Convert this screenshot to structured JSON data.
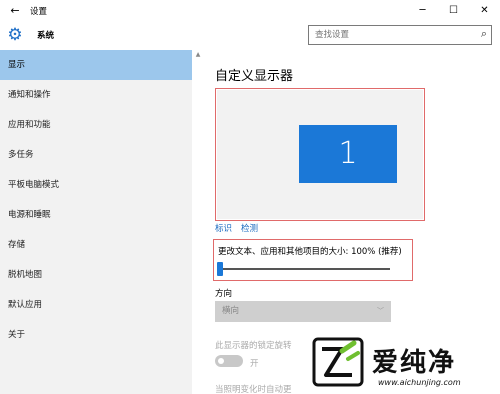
{
  "window": {
    "title": "设置",
    "back_icon": "←",
    "minimize": "─",
    "maximize": "☐",
    "close": "✕"
  },
  "header": {
    "section": "系统",
    "search_placeholder": "查找设置"
  },
  "sidebar": {
    "items": [
      {
        "label": "显示",
        "active": true
      },
      {
        "label": "通知和操作"
      },
      {
        "label": "应用和功能"
      },
      {
        "label": "多任务"
      },
      {
        "label": "平板电脑模式"
      },
      {
        "label": "电源和睡眠"
      },
      {
        "label": "存储"
      },
      {
        "label": "脱机地图"
      },
      {
        "label": "默认应用"
      },
      {
        "label": "关于"
      }
    ]
  },
  "main": {
    "heading": "自定义显示器",
    "monitor_number": "1",
    "identify_link": "标识",
    "detect_link": "检测",
    "scale_label": "更改文本、应用和其他项目的大小: 100% (推荐)",
    "scale_value_percent": 0,
    "orientation_label": "方向",
    "orientation_value": "横向",
    "rotation_lock_label": "此显示器的锁定旋转",
    "rotation_lock_state": "开",
    "auto_label": "当照明变化时自动更"
  },
  "watermark": {
    "brand": "爱纯净",
    "url": "www.aichunjing.com"
  },
  "colors": {
    "accent": "#1b78d7",
    "sidebar_active": "#9cc7ec",
    "highlight_border": "#e06a6a"
  }
}
